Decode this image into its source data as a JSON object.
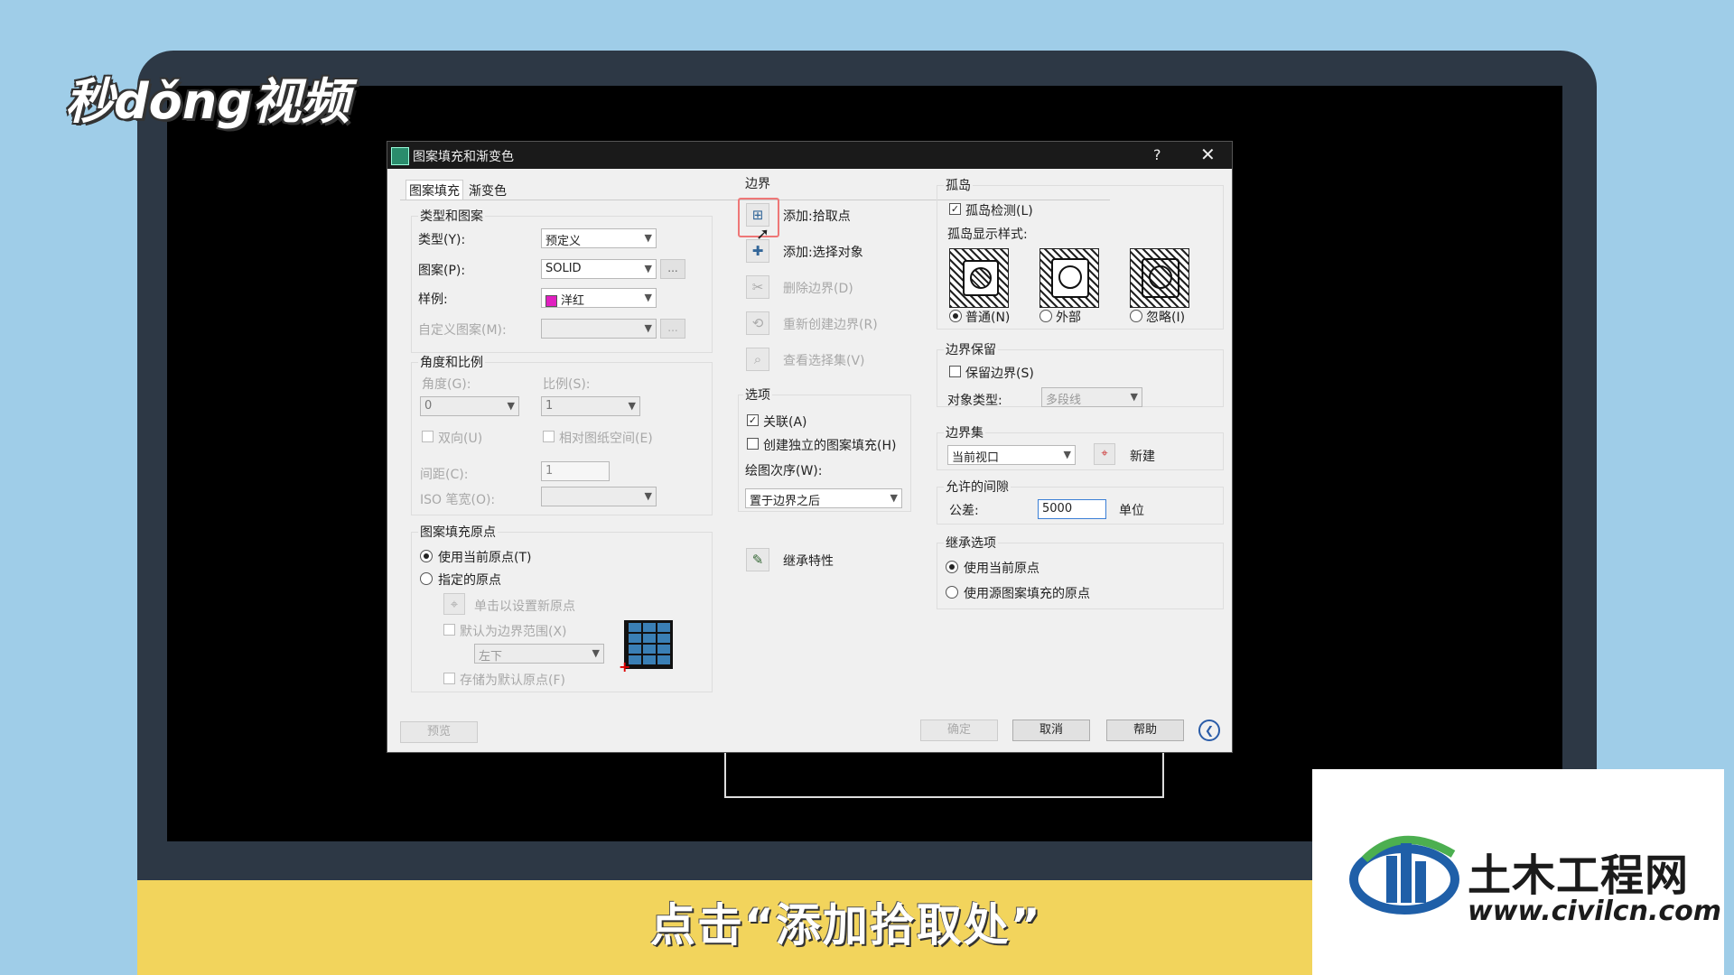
{
  "overlay": {
    "top_logo": "秒dǒng视频",
    "caption": "点击“添加拾取处”",
    "corner_logo_name": "土木工程网",
    "corner_logo_url": "www.civilcn.com"
  },
  "dialog": {
    "title": "图案填充和渐变色",
    "help_glyph": "?",
    "close_glyph": "✕",
    "tabs": [
      "图案填充",
      "渐变色"
    ],
    "type_pattern": {
      "title": "类型和图案",
      "type_label": "类型(Y):",
      "type_value": "预定义",
      "pattern_label": "图案(P):",
      "pattern_value": "SOLID",
      "swatch_label": "样例:",
      "swatch_value": "洋红",
      "swatch_color": "#e020c0",
      "custom_label": "自定义图案(M):",
      "dots": "..."
    },
    "angle_scale": {
      "title": "角度和比例",
      "angle_label": "角度(G):",
      "angle_value": "0",
      "scale_label": "比例(S):",
      "scale_value": "1",
      "double_label": "双向(U)",
      "relative_label": "相对图纸空间(E)",
      "spacing_label": "间距(C):",
      "spacing_value": "1",
      "iso_label": "ISO 笔宽(O):"
    },
    "origin": {
      "title": "图案填充原点",
      "use_current": "使用当前原点(T)",
      "specified": "指定的原点",
      "click_set": "单击以设置新原点",
      "default_extent": "默认为边界范围(X)",
      "position_value": "左下",
      "store_default": "存储为默认原点(F)"
    },
    "preview_button": "预览",
    "boundary": {
      "title": "边界",
      "add_pick": "添加:拾取点",
      "add_select": "添加:选择对象",
      "remove": "删除边界(D)",
      "recreate": "重新创建边界(R)",
      "view_selection": "查看选择集(V)"
    },
    "options": {
      "title": "选项",
      "associative": "关联(A)",
      "separate": "创建独立的图案填充(H)",
      "draw_order_label": "绘图次序(W):",
      "draw_order_value": "置于边界之后"
    },
    "inherit_button": "继承特性",
    "islands": {
      "title": "孤岛",
      "detect": "孤岛检测(L)",
      "style_label": "孤岛显示样式:",
      "normal": "普通(N)",
      "outer": "外部",
      "ignore": "忽略(I)"
    },
    "retain": {
      "title": "边界保留",
      "retain_label": "保留边界(S)",
      "object_type_label": "对象类型:",
      "object_type_value": "多段线"
    },
    "boundary_set": {
      "title": "边界集",
      "value": "当前视口",
      "new_label": "新建"
    },
    "gap": {
      "title": "允许的间隙",
      "tolerance_label": "公差:",
      "tolerance_value": "5000",
      "unit_label": "单位"
    },
    "inherit_options": {
      "title": "继承选项",
      "use_current": "使用当前原点",
      "use_source": "使用源图案填充的原点"
    },
    "buttons": {
      "ok": "确定",
      "cancel": "取消",
      "help": "帮助",
      "collapse_glyph": "❮"
    }
  }
}
